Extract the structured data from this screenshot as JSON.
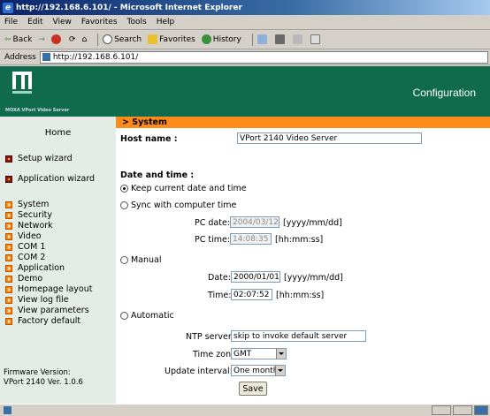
{
  "window": {
    "title": "http://192.168.6.101/ - Microsoft Internet Explorer"
  },
  "menu": [
    "File",
    "Edit",
    "View",
    "Favorites",
    "Tools",
    "Help"
  ],
  "toolbar": {
    "back": "Back",
    "search": "Search",
    "favorites": "Favorites",
    "history": "History"
  },
  "address": {
    "label": "Address",
    "url": "http://192.168.6.101/"
  },
  "banner": {
    "logo": "MOXA",
    "logo_sub": "MOXA VPort Video Server",
    "heading": "Configuration"
  },
  "sidebar": {
    "home": "Home",
    "top_items": [
      {
        "label": "Setup wizard",
        "icon": "star-box-icon"
      },
      {
        "label": "Application wizard",
        "icon": "star-box-icon"
      }
    ],
    "items": [
      {
        "label": "System"
      },
      {
        "label": "Security"
      },
      {
        "label": "Network"
      },
      {
        "label": "Video"
      },
      {
        "label": "COM 1"
      },
      {
        "label": "COM 2"
      },
      {
        "label": "Application"
      },
      {
        "label": "Demo"
      },
      {
        "label": "Homepage layout"
      },
      {
        "label": "View log file"
      },
      {
        "label": "View parameters"
      },
      {
        "label": "Factory default"
      }
    ],
    "firmware_label": "Firmware Version:",
    "firmware_value": "VPort 2140 Ver. 1.0.6"
  },
  "main": {
    "section": "> System",
    "host_label": "Host name :",
    "host_value": "VPort 2140 Video Server",
    "datetime_label": "Date and time :",
    "opt_keep": "Keep current date and time",
    "opt_sync": "Sync with computer time",
    "pc_date_label": "PC date:",
    "pc_date_value": "2004/03/12",
    "pc_date_fmt": "[yyyy/mm/dd]",
    "pc_time_label": "PC time:",
    "pc_time_value": "14:08:35",
    "pc_time_fmt": "[hh:mm:ss]",
    "opt_manual": "Manual",
    "date_label": "Date:",
    "date_value": "2000/01/01",
    "date_fmt": "[yyyy/mm/dd]",
    "time_label": "Time:",
    "time_value": "02:07:52",
    "time_fmt": "[hh:mm:ss]",
    "opt_auto": "Automatic",
    "ntp_label": "NTP server:",
    "ntp_value": "skip to invoke default server",
    "tz_label": "Time zone:",
    "tz_value": "GMT",
    "interval_label": "Update interval:",
    "interval_value": "One month",
    "save": "Save",
    "selected_option": "keep"
  },
  "colors": {
    "banner": "#0f6b4c",
    "sidebar": "#e4ece6",
    "section_bar": "#ff8c1a"
  }
}
